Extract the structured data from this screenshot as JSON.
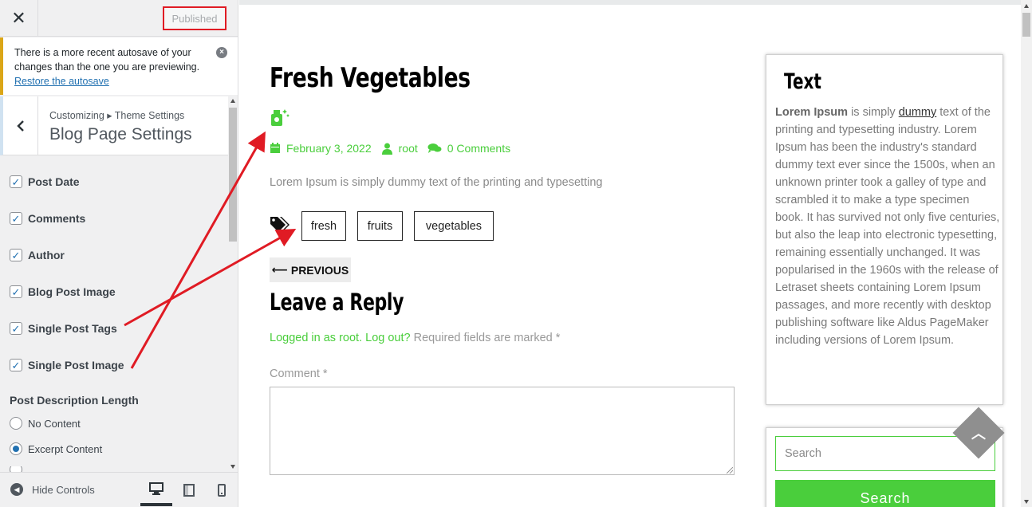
{
  "customizer": {
    "close_icon": "close-icon",
    "publish_label": "Published",
    "notice": {
      "text": "There is a more recent autosave of your changes than the one you are previewing.",
      "link": "Restore the autosave"
    },
    "breadcrumb": "Customizing ▸ Theme Settings",
    "section_title": "Blog Page Settings",
    "checkboxes": [
      {
        "label": "Post Date",
        "checked": true
      },
      {
        "label": "Comments",
        "checked": true
      },
      {
        "label": "Author",
        "checked": true
      },
      {
        "label": "Blog Post Image",
        "checked": true
      },
      {
        "label": "Single Post Tags",
        "checked": true
      },
      {
        "label": "Single Post Image",
        "checked": true
      }
    ],
    "description_title": "Post Description Length",
    "radios": [
      {
        "label": "No Content",
        "selected": false
      },
      {
        "label": "Excerpt Content",
        "selected": true
      }
    ],
    "hide_controls": "Hide Controls",
    "devices": [
      "desktop",
      "tablet",
      "mobile"
    ]
  },
  "post": {
    "title": "Fresh Vegetables",
    "date": "February 3, 2022",
    "author": "root",
    "comments": "0 Comments",
    "excerpt": "Lorem Ipsum is simply dummy text of the printing and typesetting",
    "tags": [
      "fresh",
      "fruits",
      "vegetables"
    ],
    "previous": "PREVIOUS",
    "reply_title": "Leave a Reply",
    "logged_in": "Logged in as root.",
    "log_out": "Log out?",
    "required": "Required fields are marked",
    "required_star": "*",
    "comment_label": "Comment",
    "comment_star": "*"
  },
  "widget_text": {
    "title": "Text",
    "bold": "Lorem Ipsum",
    "mid": " is simply ",
    "link": "dummy",
    "rest": " text of the printing and typesetting industry. Lorem Ipsum has been the industry's standard dummy text ever since the 1500s, when an unknown printer took a galley of type and scrambled it to make a type specimen book. It has survived not only five centuries, but also the leap into electronic typesetting, remaining essentially unchanged. It was popularised in the 1960s with the release of Letraset sheets containing Lorem Ipsum passages, and more recently with desktop publishing software like Aldus PageMaker including versions of Lorem Ipsum."
  },
  "widget_search": {
    "placeholder": "Search",
    "button": "Search"
  },
  "colors": {
    "accent_green": "#4ace3c",
    "annotation_red": "#e01b24",
    "notice_border": "#dba617",
    "link_blue": "#2271b1"
  }
}
